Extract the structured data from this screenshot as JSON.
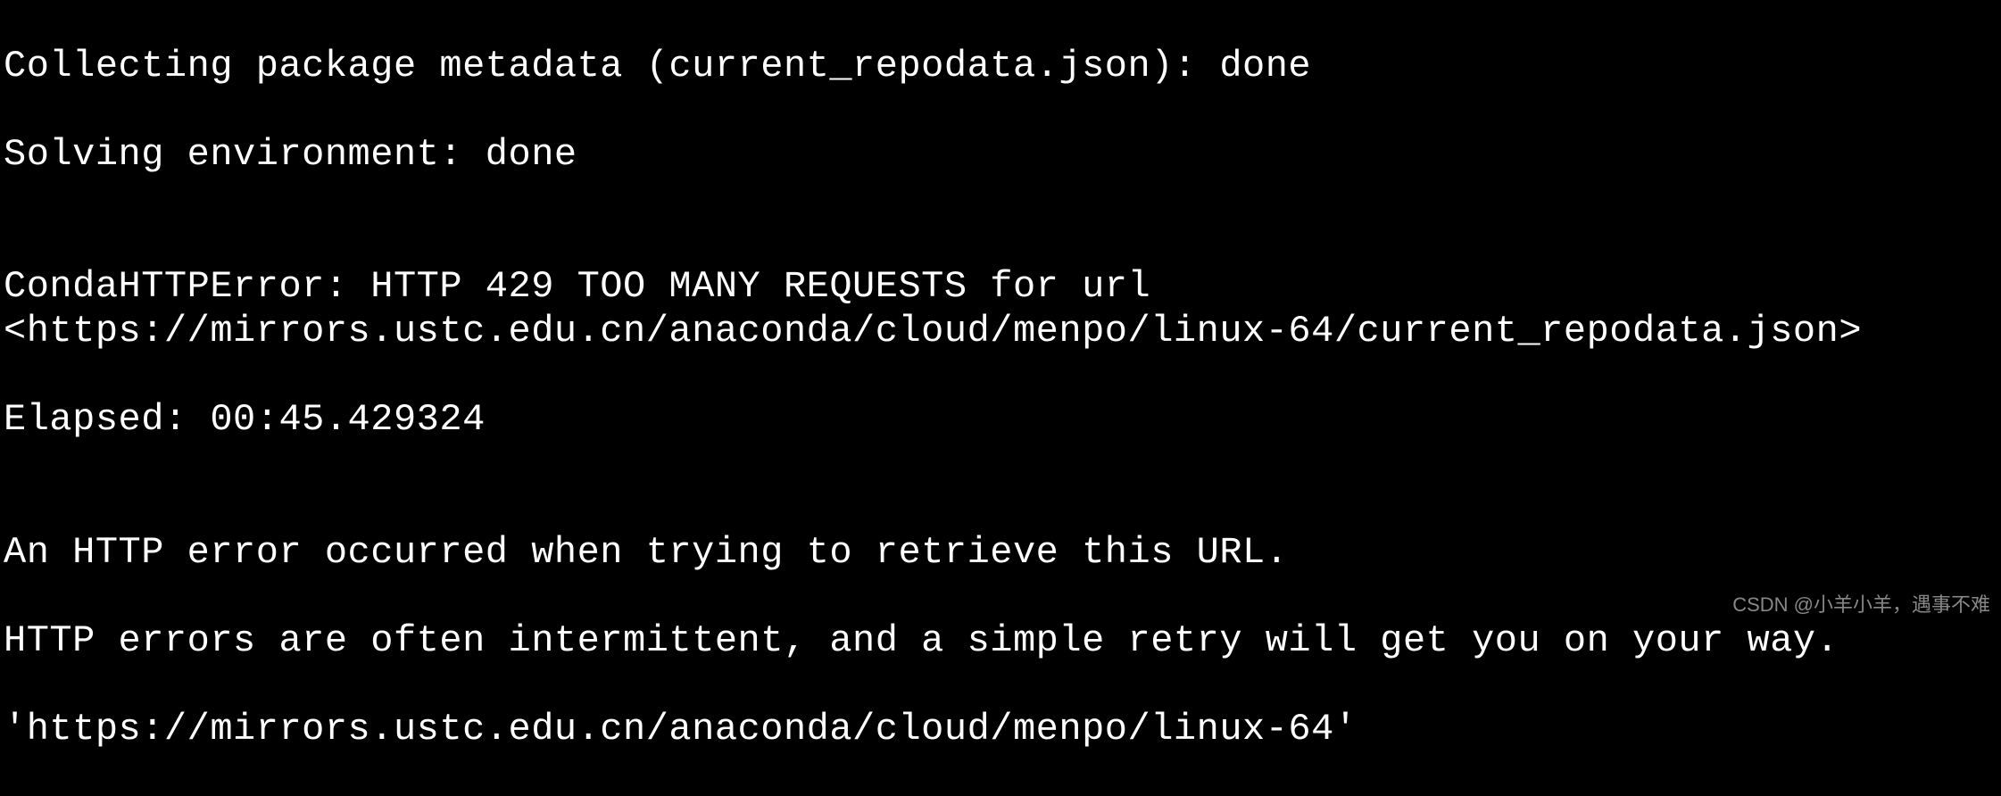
{
  "terminal": {
    "lines": [
      "Collecting package metadata (current_repodata.json): done",
      "Solving environment: done",
      "",
      "CondaHTTPError: HTTP 429 TOO MANY REQUESTS for url <https://mirrors.ustc.edu.cn/anaconda/cloud/menpo/linux-64/current_repodata.json>",
      "Elapsed: 00:45.429324",
      "",
      "An HTTP error occurred when trying to retrieve this URL.",
      "HTTP errors are often intermittent, and a simple retry will get you on your way.",
      "'https://mirrors.ustc.edu.cn/anaconda/cloud/menpo/linux-64'"
    ]
  },
  "watermark": "CSDN @小羊小羊，遇事不难"
}
